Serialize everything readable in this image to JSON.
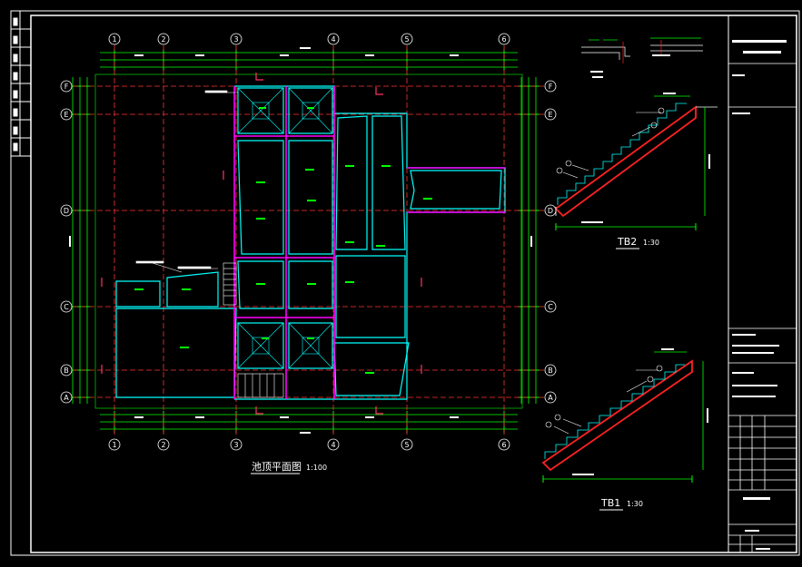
{
  "plan": {
    "title": "池顶平面图",
    "scale": "1:100",
    "column_labels": [
      "1",
      "2",
      "3",
      "4",
      "5",
      "6"
    ],
    "row_labels": [
      "F",
      "E",
      "D",
      "C",
      "B",
      "A"
    ]
  },
  "details": {
    "tb2_title": "TB2",
    "tb2_scale": "1:30",
    "tb1_title": "TB1",
    "tb1_scale": "1:30"
  },
  "colors": {
    "background": "#000000",
    "frame": "#ffffff",
    "dimension": "#00ff00",
    "grid_axis": "#ff3333",
    "outline": "#00ffff",
    "beam": "#ff00ff",
    "rebar": "#ff2222",
    "text": "#ffffff"
  }
}
